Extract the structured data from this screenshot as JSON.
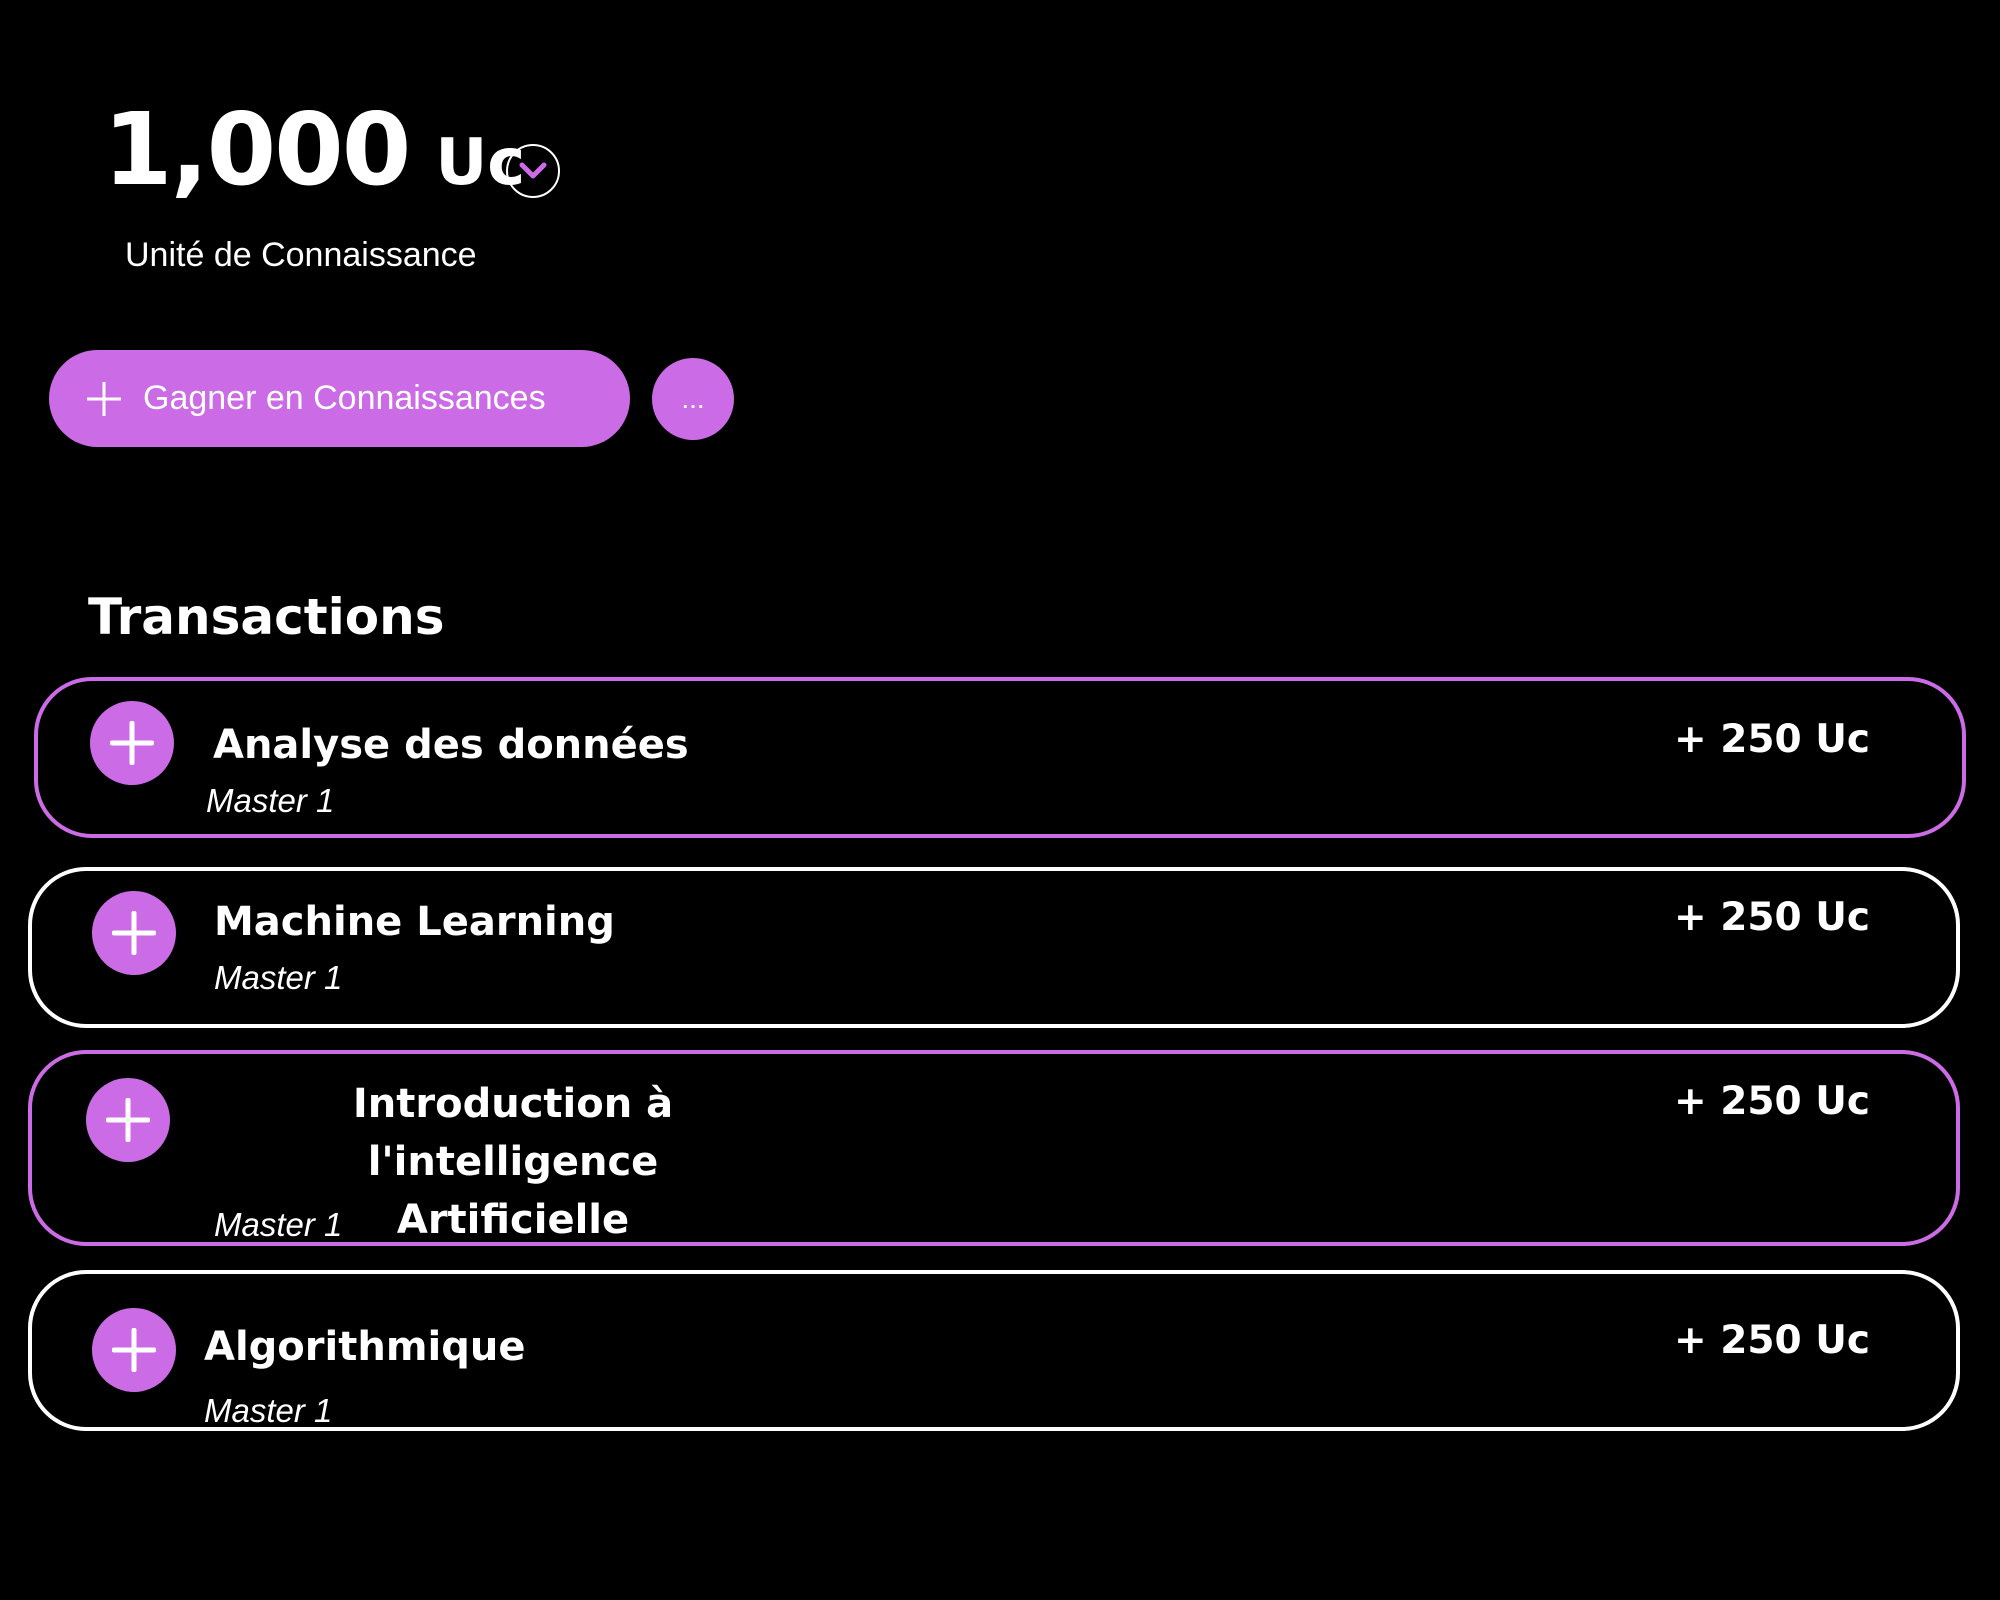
{
  "balance": {
    "amount": "1,000",
    "unit": "Uc",
    "subtitle": "Unité de Connaissance"
  },
  "actions": {
    "primary_label": "Gagner en Connaissances",
    "more_label": "..."
  },
  "transactions": {
    "title": "Transactions",
    "items": [
      {
        "title": "Analyse des données",
        "level": "Master 1",
        "amount": "+ 250 Uc"
      },
      {
        "title": "Machine Learning",
        "level": "Master 1",
        "amount": "+ 250 Uc"
      },
      {
        "title_line1": "Introduction à l'intelligence",
        "title_line2": "Artificielle",
        "level": "Master 1",
        "amount": "+ 250 Uc"
      },
      {
        "title": "Algorithmique",
        "level": "Master 1",
        "amount": "+ 250 Uc"
      }
    ]
  },
  "colors": {
    "accent": "#cb6ce6",
    "background": "#000000",
    "text": "#ffffff"
  },
  "icons": {
    "dropdown": "chevron-down-icon",
    "add": "plus-icon"
  }
}
